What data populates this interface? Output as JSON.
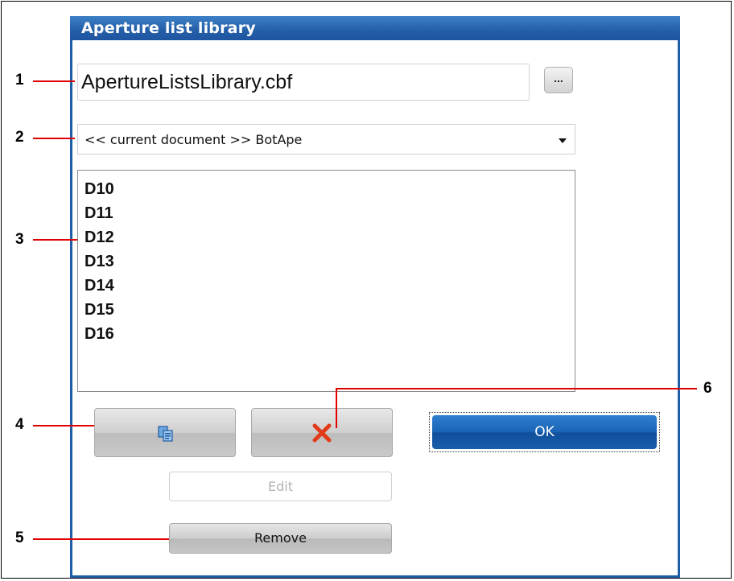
{
  "dialog": {
    "title": "Aperture list library",
    "file_name": "ApertureListsLibrary.cbf",
    "browse_label": "...",
    "combo_value": "<< current document >> BotApe",
    "list_items": [
      "D10",
      "D11",
      "D12",
      "D13",
      "D14",
      "D15",
      "D16"
    ],
    "ok_label": "OK",
    "edit_label": "Edit",
    "remove_label": "Remove"
  },
  "callouts": [
    "1",
    "2",
    "3",
    "4",
    "5",
    "6"
  ],
  "colors": {
    "title_bar": "#245ea8",
    "ok_button": "#1a63b5",
    "callout_line": "#e00000",
    "delete_icon": "#e23b1a"
  },
  "icons": {
    "copy_button_icon": "copy-icon",
    "delete_button_icon": "close-icon",
    "combo_icon": "chevron-down-icon",
    "resize_icon": "resize-grip-icon"
  }
}
